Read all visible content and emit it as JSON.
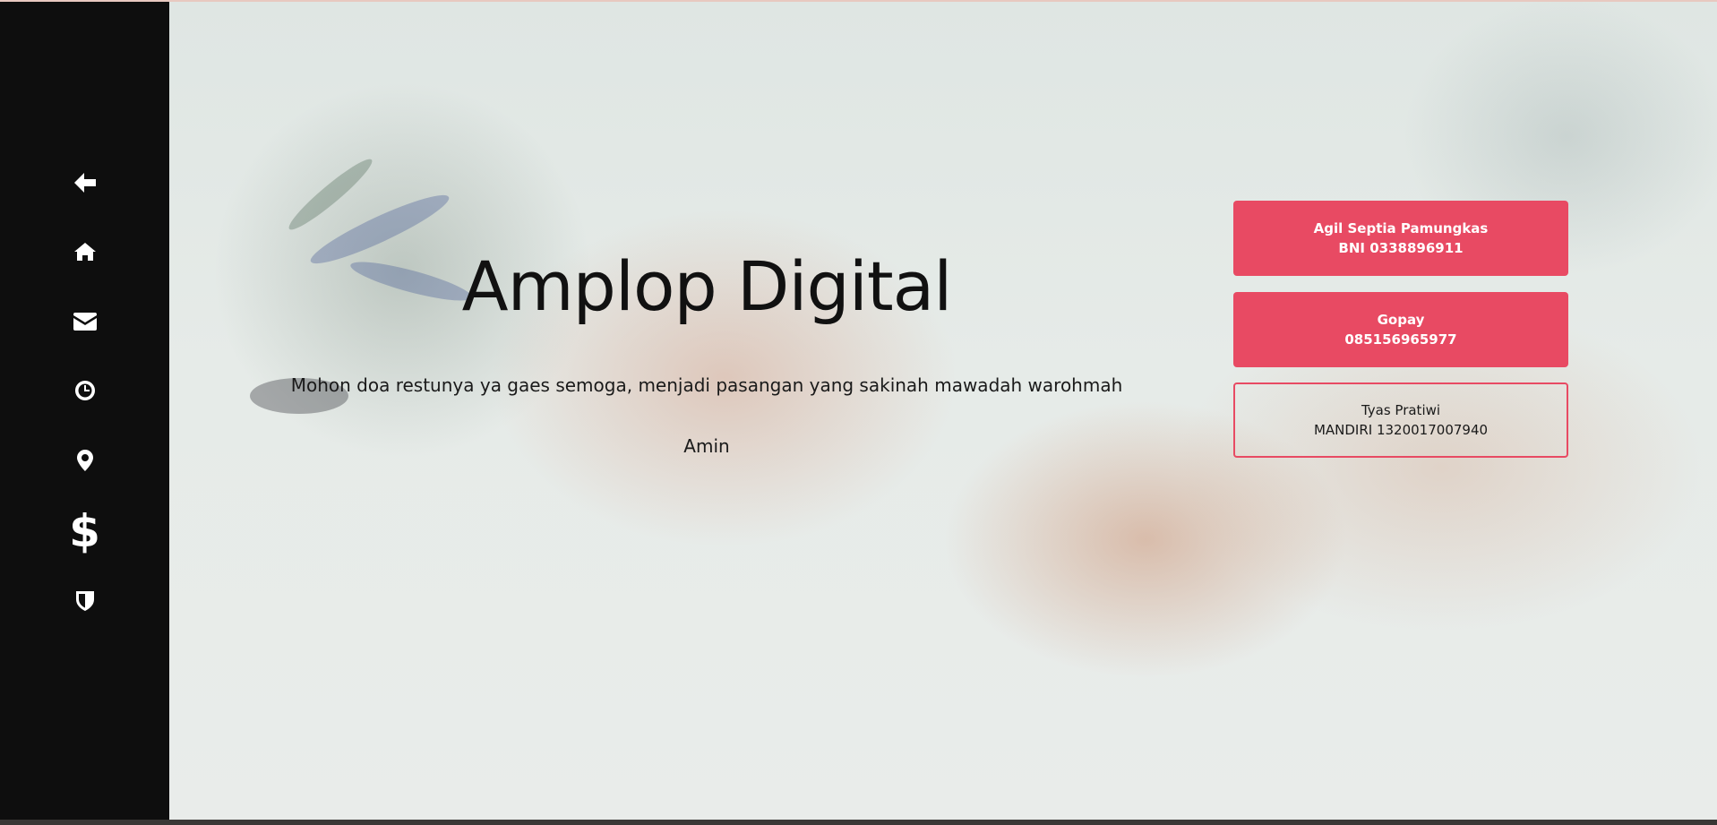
{
  "sidebar": {
    "items": [
      {
        "icon": "arrow-left-icon",
        "label": "back"
      },
      {
        "icon": "home-icon",
        "label": "home"
      },
      {
        "icon": "envelope-icon",
        "label": "message"
      },
      {
        "icon": "clock-icon",
        "label": "time"
      },
      {
        "icon": "map-pin-icon",
        "label": "location"
      },
      {
        "icon": "dollar-icon",
        "label": "gift"
      },
      {
        "icon": "shield-icon",
        "label": "protocol"
      }
    ]
  },
  "hero": {
    "title": "Amplop Digital",
    "message": "Mohon doa restunya ya gaes semoga, menjadi pasangan yang sakinah mawadah warohmah",
    "closing": "Amin"
  },
  "accounts": [
    {
      "name": "Agil Septia Pamungkas",
      "detail": "BNI 0338896911",
      "style": "filled"
    },
    {
      "name": "Gopay",
      "detail": "085156965977",
      "style": "filled"
    },
    {
      "name": "Tyas Pratiwi",
      "detail": "MANDIRI 1320017007940",
      "style": "outline"
    }
  ],
  "colors": {
    "accent": "#e84a63",
    "sidebar": "#0e0e0e"
  }
}
